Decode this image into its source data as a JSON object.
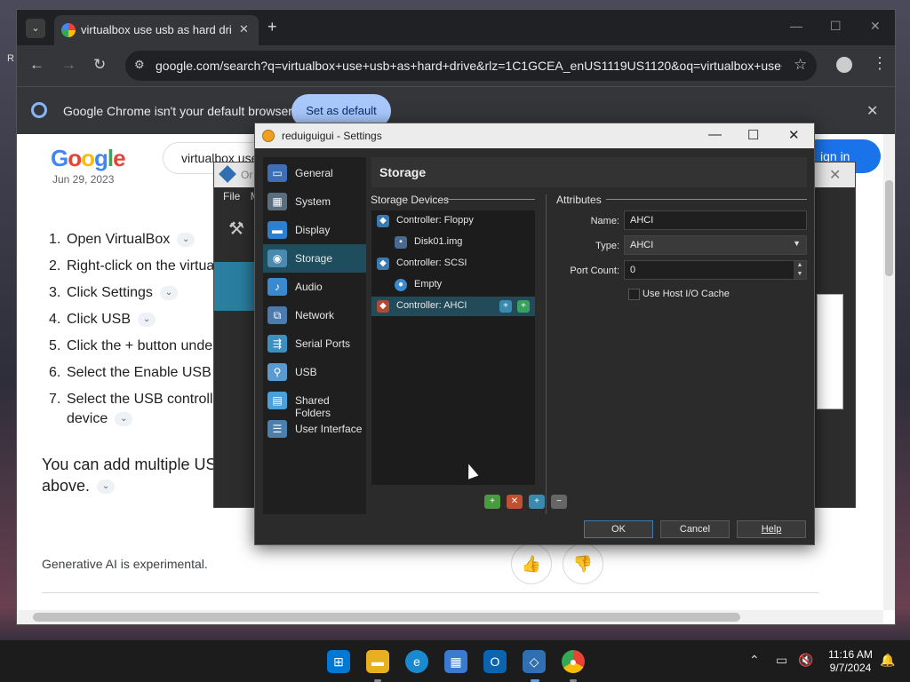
{
  "chrome": {
    "tab_title": "virtualbox use usb as hard drive",
    "url": "google.com/search?q=virtualbox+use+usb+as+hard+drive&rlz=1C1GCEA_enUS1119US1120&oq=virtualbox+use+u...",
    "infobar_text": "Google Chrome isn't your default browser",
    "set_default_label": "Set as default"
  },
  "page": {
    "search_query": "virtualbox use",
    "sign_in": "ign in",
    "date": "Jun 29, 2023",
    "steps": [
      {
        "num": "1.",
        "text": "Open VirtualBox"
      },
      {
        "num": "2.",
        "text": "Right-click on the virtua"
      },
      {
        "num": "3.",
        "text": "Click Settings"
      },
      {
        "num": "4.",
        "text": "Click USB"
      },
      {
        "num": "5.",
        "text": "Click the + button under"
      },
      {
        "num": "6.",
        "text": "Select the Enable USB"
      },
      {
        "num": "7.",
        "text": "Select the USB controlle"
      },
      {
        "num": "",
        "text": "device"
      }
    ],
    "paragraph": "You can add multiple US above.",
    "ai_note": "Generative AI is experimental."
  },
  "vbox_manager": {
    "title": "Or",
    "menu_file": "File",
    "menu_m": "M"
  },
  "dialog": {
    "title": "reduiguigui - Settings",
    "nav": [
      {
        "label": "General",
        "icon": "general-icon",
        "color": "#3d6fb8"
      },
      {
        "label": "System",
        "icon": "system-icon",
        "color": "#5a6e80"
      },
      {
        "label": "Display",
        "icon": "display-icon",
        "color": "#2d7fd0"
      },
      {
        "label": "Storage",
        "icon": "storage-icon",
        "color": "#4a8ab0"
      },
      {
        "label": "Audio",
        "icon": "audio-icon",
        "color": "#3a8ad0"
      },
      {
        "label": "Network",
        "icon": "network-icon",
        "color": "#4a7ab0"
      },
      {
        "label": "Serial Ports",
        "icon": "serial-ports-icon",
        "color": "#3a90c0"
      },
      {
        "label": "USB",
        "icon": "usb-icon",
        "color": "#5a9ad0"
      },
      {
        "label": "Shared Folders",
        "icon": "shared-folders-icon",
        "color": "#4aa0d8"
      },
      {
        "label": "User Interface",
        "icon": "user-interface-icon",
        "color": "#4a80b0"
      }
    ],
    "selected_nav": "Storage",
    "section_title": "Storage",
    "storage_devices_label": "Storage Devices",
    "attributes_label": "Attributes",
    "tree": [
      {
        "label": "Controller: Floppy",
        "level": 0,
        "icon": "floppy-controller-icon"
      },
      {
        "label": "Disk01.img",
        "level": 1,
        "icon": "floppy-disk-icon"
      },
      {
        "label": "Controller: SCSI",
        "level": 0,
        "icon": "scsi-controller-icon"
      },
      {
        "label": "Empty",
        "level": 1,
        "icon": "optical-disc-icon"
      },
      {
        "label": "Controller: AHCI",
        "level": 0,
        "icon": "ahci-controller-icon",
        "selected": true
      }
    ],
    "name_label": "Name:",
    "name_value": "AHCI",
    "type_label": "Type:",
    "type_value": "AHCI",
    "port_count_label": "Port Count:",
    "port_count_value": "0",
    "host_io_cache_label": "Use Host I/O Cache",
    "ok": "OK",
    "cancel": "Cancel",
    "help": "Help"
  },
  "taskbar": {
    "time": "11:16 AM",
    "date": "9/7/2024"
  }
}
